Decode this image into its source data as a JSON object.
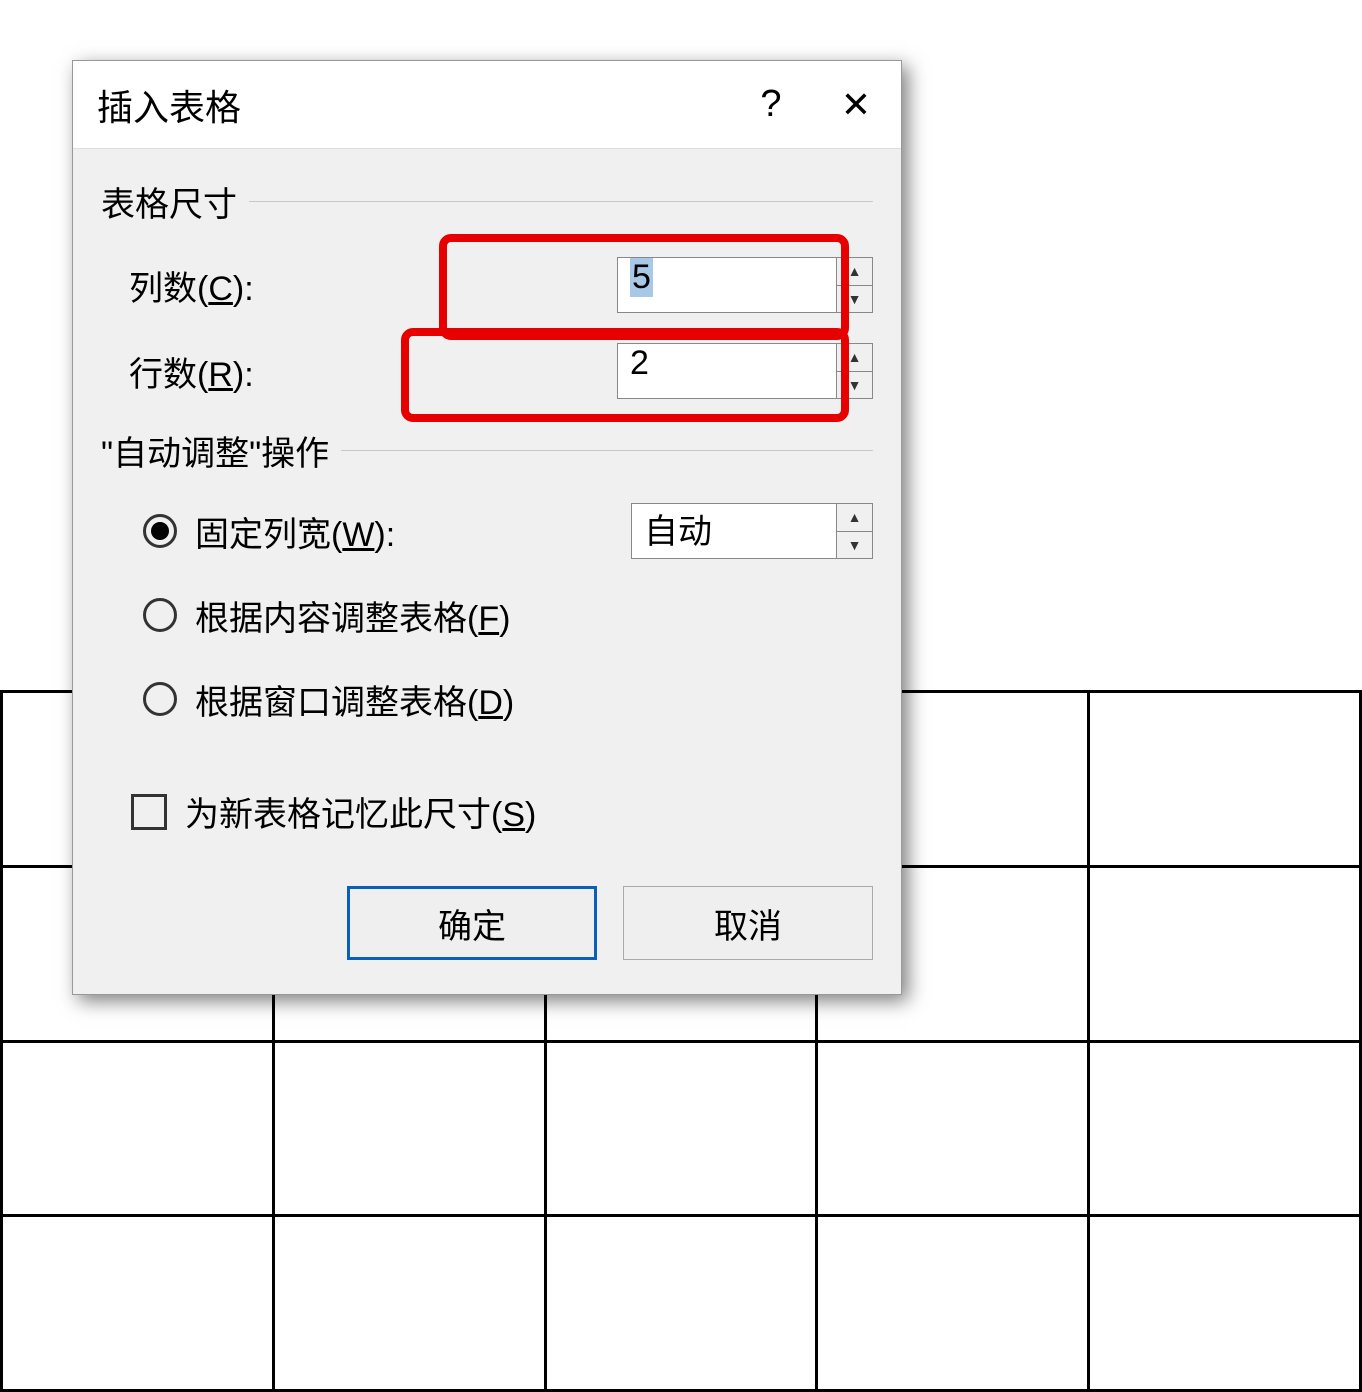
{
  "dialog": {
    "title": "插入表格",
    "help_symbol": "?",
    "close_symbol": "✕",
    "size_group_label": "表格尺寸",
    "columns_label_pre": "列数(",
    "columns_label_key": "C",
    "columns_label_post": "):",
    "columns_value": "5",
    "rows_label_pre": "行数(",
    "rows_label_key": "R",
    "rows_label_post": "):",
    "rows_value": "2",
    "autofit_group_label": "\"自动调整\"操作",
    "fixed_width_pre": "固定列宽(",
    "fixed_width_key": "W",
    "fixed_width_post": "):",
    "fixed_width_value": "自动",
    "autofit_content_pre": "根据内容调整表格(",
    "autofit_content_key": "F",
    "autofit_content_post": ")",
    "autofit_window_pre": "根据窗口调整表格(",
    "autofit_window_key": "D",
    "autofit_window_post": ")",
    "remember_pre": "为新表格记忆此尺寸(",
    "remember_key": "S",
    "remember_post": ")",
    "ok_label": "确定",
    "cancel_label": "取消",
    "spin_up": "▲",
    "spin_down": "▼"
  }
}
